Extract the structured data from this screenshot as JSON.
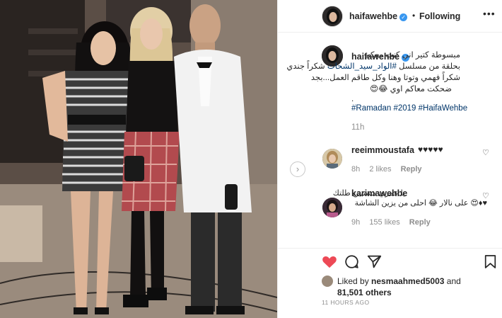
{
  "post": {
    "username": "haifawehbe",
    "verified": true,
    "follow_status": "Following",
    "more_icon": "more-options-icon"
  },
  "caption": {
    "username": "haifawehbe",
    "line1": "مبسوطة كتير اني كنت معكم",
    "line2a": "بحلقة من مسلسل ",
    "line2b": "#الواد_سيد_الشحات",
    "line2c": " شكراً جندي",
    "line3": "شكراً فهمي وتوتا وهنا وكل طاقم العمل...بجد",
    "line4": "ضحكت معاكم اوي 😂😍",
    "dot": ".",
    "hashtags": "#Ramadan #2019 #HaifaWehbe",
    "time": "11h"
  },
  "comments": [
    {
      "username": "reeimmoustafa",
      "text": "♥♥♥♥♥",
      "time": "8h",
      "likes": "2 likes",
      "reply": "Reply"
    },
    {
      "username": "karimawehbe",
      "line1": "يا عمري مستبين طلتك",
      "line2": "♥♦😍 على نالار 😂 احلى من يزين الشاشة",
      "time": "9h",
      "likes": "155 likes",
      "reply": "Reply"
    }
  ],
  "footer": {
    "liked_prefix": "Liked by ",
    "liked_user": "nesmaahmed5003",
    "liked_and": " and",
    "liked_count": "81,501 others",
    "timestamp": "11 HOURS AGO"
  },
  "colors": {
    "heart_red": "#ed4956",
    "link_blue": "#003569",
    "muted_gray": "#8e8e8e",
    "verified_blue": "#3897f0"
  }
}
